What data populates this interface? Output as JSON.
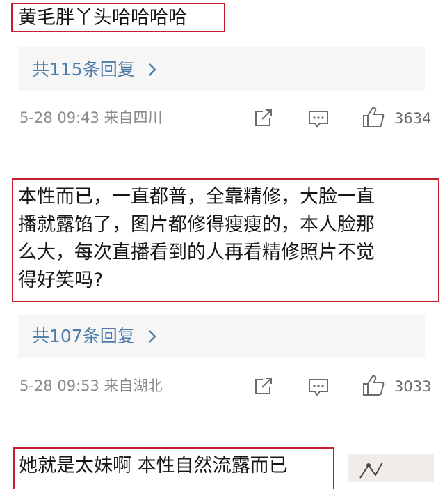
{
  "comments": [
    {
      "text": "黄毛胖丫头哈哈哈哈",
      "reply_link": "共115条回复",
      "meta": "5-28 09:43 来自四川",
      "likes": "3634"
    },
    {
      "lines": [
        "本性而已，一直都普，全靠精修，大脸一直",
        "播就露馅了，图片都修得瘦瘦的，本人脸那",
        "么大，每次直播看到的人再看精修照片不觉",
        "得好笑吗?"
      ],
      "reply_link": "共107条回复",
      "meta": "5-28 09:53 来自湖北",
      "likes": "3033"
    },
    {
      "text": "她就是太妹啊 本性自然流露而已"
    }
  ],
  "icons": {
    "share": "share-icon",
    "comment": "comment-icon",
    "like": "thumbs-up-icon",
    "chevron": "chevron-right-icon"
  },
  "colors": {
    "highlight_border": "#c4202b",
    "reply_link": "#4d7da8",
    "meta_text": "#8b8b8b"
  }
}
